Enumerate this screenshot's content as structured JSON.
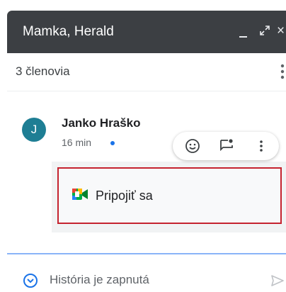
{
  "chat": {
    "title": "Mamka, Herald",
    "members": "3 členovia"
  },
  "message": {
    "avatar_letter": "J",
    "sender": "Janko Hraško",
    "time": "16 min",
    "join_label": "Pripojiť sa"
  },
  "footer": {
    "history_text": "História je zapnutá"
  },
  "icons": [
    "minimize-icon",
    "expand-icon",
    "close-icon",
    "more-vert-icon",
    "emoji-icon",
    "reply-in-thread-icon",
    "google-meet-icon",
    "history-toggle-icon",
    "send-icon"
  ],
  "colors": {
    "header_bg": "#3c3f43",
    "avatar_bg": "#1e7e94",
    "unread_dot": "#1a73e8",
    "highlight_border": "#c5232f",
    "divider": "#8ab4f8"
  }
}
